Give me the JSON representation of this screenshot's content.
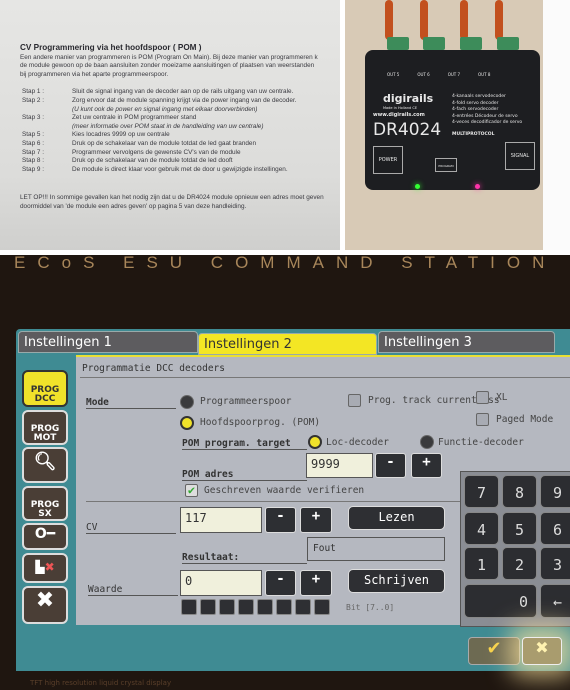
{
  "document": {
    "title": "CV Programmering via het hoofdspoor ( POM )",
    "intro": [
      "Een andere manier van programmeren is POM (Program On Main). Bij deze manier van programmeren k",
      "de module gewoon op de baan aansluiten zonder moeizame aansluitingen of plaatsen van weerstanden",
      "bij programmeren via het aparte programmeerspoor."
    ],
    "steps": [
      {
        "label": "Stap 1 :",
        "text": "Sluit de signal ingang van de decoder aan op de rails uitgang van uw centrale."
      },
      {
        "label": "Stap 2 :",
        "text": "Zorg ervoor dat de module spanning krijgt via de power ingang van de decoder."
      },
      {
        "label": "",
        "text": "(U kunt ook de power en signal ingang met elkaar doorverbinden)",
        "italic": true
      },
      {
        "label": "Stap 3 :",
        "text": "Zet uw centrale in POM programmeer stand"
      },
      {
        "label": "",
        "text": "(meer informatie over POM staat in de handleiding van uw centrale)",
        "italic": true
      },
      {
        "label": "Stap 5 :",
        "text": "Kies locadres 9999 op uw centrale"
      },
      {
        "label": "Stap 6 :",
        "text": "Druk op de schakelaar van de module totdat de led gaat branden"
      },
      {
        "label": "Stap 7 :",
        "text": "Programmeer vervolgens de gewenste CV's van de module"
      },
      {
        "label": "Stap 8 :",
        "text": "Druk op de schakelaar van de module totdat de led dooft"
      },
      {
        "label": "Stap 9 :",
        "text": "De module is direct klaar voor gebruik met de door u gewijzigde instellingen."
      }
    ],
    "note": [
      "LET OP!!! In sommige gevallen kan het nodig zijn dat u de DR4024 module opnieuw een adres moet geven",
      "doormiddel van 'de module een adres geven' op pagina 5 van deze handleiding."
    ]
  },
  "device": {
    "brand": "digirails",
    "made_in": "Made in Holland CE",
    "url": "www.digirails.com",
    "model": "DR4024",
    "descriptions": [
      "4-kanaals servodecoder",
      "4-fold servo decoder",
      "4-fach servodecoder",
      "4-entrées Décodeur de servo",
      "4-veces decodificador de servo"
    ],
    "protocol": "MULTIPROTOCOL",
    "power_label": "POWER",
    "program_label": "PROGRAM",
    "signal_label": "SIGNAL",
    "outputs": [
      "OUT 5",
      "OUT 6",
      "OUT 7",
      "OUT 8"
    ]
  },
  "station": {
    "brand": "ECoS ESU COMMAND STATION",
    "footer": "TFT high resolution liquid crystal display",
    "tabs": [
      {
        "label": "Instellingen 1"
      },
      {
        "label": "Instellingen 2",
        "active": true
      },
      {
        "label": "Instellingen 3"
      }
    ],
    "sidebar": [
      {
        "label": "PROG DCC",
        "active": true
      },
      {
        "label": "PROG MOT"
      },
      {
        "icon": "search-icon"
      },
      {
        "label": "PROG SX"
      },
      {
        "icon": "key-icon"
      },
      {
        "icon": "loco-delete-icon"
      },
      {
        "icon": "tools-icon"
      }
    ],
    "panel": {
      "title": "Programmatie DCC decoders",
      "mode_label": "Mode",
      "mode_options": [
        {
          "label": "Programmeerspoor",
          "selected": false
        },
        {
          "label": "Hoofdspoorprog. (POM)",
          "selected": true
        }
      ],
      "prog_track_currentless": {
        "label": "Prog. track currentless",
        "checked": false
      },
      "xl": {
        "label": "XL",
        "checked": false
      },
      "paged_mode": {
        "label": "Paged Mode",
        "checked": false
      },
      "target_label": "POM program. target",
      "target_options": [
        {
          "label": "Loc-decoder",
          "selected": true
        },
        {
          "label": "Functie-decoder",
          "selected": false
        }
      ],
      "pom_address_label": "POM adres",
      "pom_address": "9999",
      "verify": {
        "label": "Geschreven waarde verifieren",
        "checked": true
      },
      "cv_label": "CV",
      "cv_value": "117",
      "read_label": "Lezen",
      "result_label": "Resultaat:",
      "result_value": "Fout",
      "value_label": "Waarde",
      "value": "0",
      "write_label": "Schrijven",
      "bits_label": "Bit [7..0]",
      "bits": [
        0,
        0,
        0,
        0,
        0,
        0,
        0,
        0
      ],
      "minus": "-",
      "plus": "+"
    },
    "keypad": [
      "7",
      "8",
      "9",
      "4",
      "5",
      "6",
      "1",
      "2",
      "3",
      "0",
      "←"
    ],
    "ok": "✔",
    "cancel": "✖"
  },
  "colors": {
    "tab_active": "#f3e624",
    "ui_teal": "#3f8b93",
    "panel": "#b5b8c0"
  }
}
